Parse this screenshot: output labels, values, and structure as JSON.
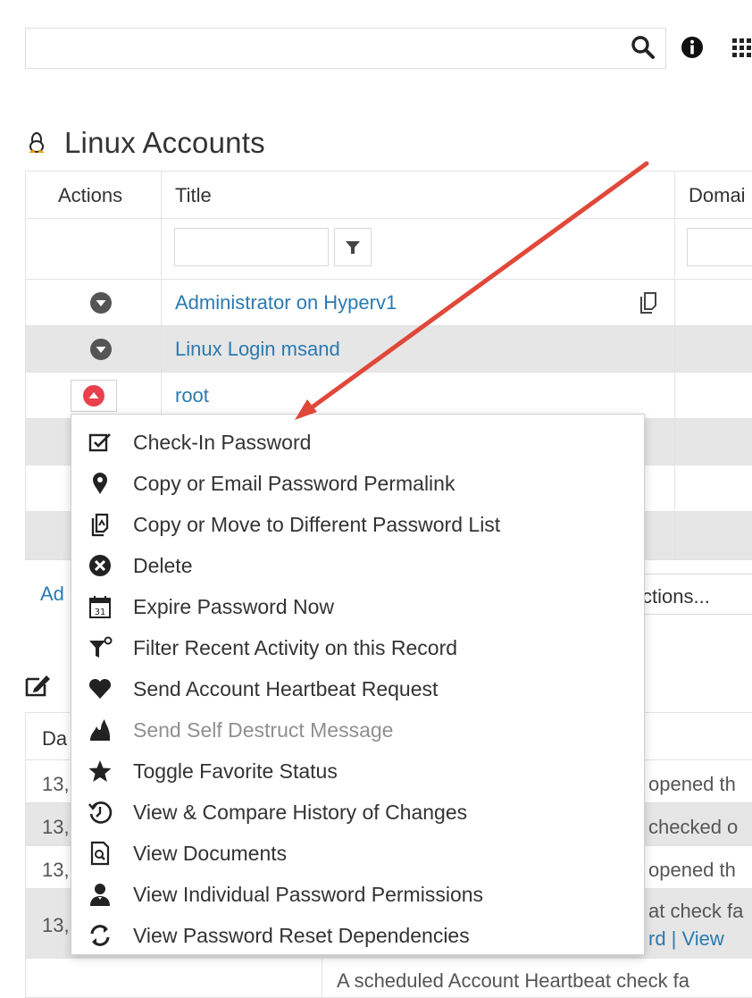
{
  "search": {
    "value": "",
    "placeholder": ""
  },
  "section": {
    "title": "Linux Accounts"
  },
  "grid": {
    "columns": [
      "Actions",
      "Title",
      "Domai"
    ],
    "rows": [
      {
        "title": "Administrator on Hyperv1"
      },
      {
        "title": "Linux Login msand"
      },
      {
        "title": "root"
      }
    ]
  },
  "lower": {
    "add_link": "Ad",
    "actions_label": "ctions...",
    "activity_header": "Da",
    "activity_rows": [
      {
        "date": "13,",
        "desc": "opened th"
      },
      {
        "date": "13,",
        "desc": "checked o"
      },
      {
        "date": "13,",
        "desc": "opened th"
      },
      {
        "date": "13,",
        "desc": "at check fa",
        "links": "rd  |  View"
      },
      {
        "date": "",
        "desc": "A scheduled Account Heartbeat check fa"
      }
    ]
  },
  "menu": {
    "items": [
      {
        "label": "Check-In Password",
        "icon": "check-in-icon"
      },
      {
        "label": "Copy or Email Password Permalink",
        "icon": "map-pin-icon"
      },
      {
        "label": "Copy or Move to Different Password List",
        "icon": "copy-move-icon"
      },
      {
        "label": "Delete",
        "icon": "delete-icon"
      },
      {
        "label": "Expire Password Now",
        "icon": "calendar-icon"
      },
      {
        "label": "Filter Recent Activity on this Record",
        "icon": "filter-icon"
      },
      {
        "label": "Send Account Heartbeat Request",
        "icon": "heart-icon"
      },
      {
        "label": "Send Self Destruct Message",
        "icon": "fire-icon",
        "disabled": true
      },
      {
        "label": "Toggle Favorite Status",
        "icon": "star-icon"
      },
      {
        "label": "View & Compare History of Changes",
        "icon": "history-icon"
      },
      {
        "label": "View Documents",
        "icon": "document-icon"
      },
      {
        "label": "View Individual Password Permissions",
        "icon": "user-icon"
      },
      {
        "label": "View Password Reset Dependencies",
        "icon": "refresh-icon"
      }
    ]
  },
  "colors": {
    "link": "#2a7ab0",
    "arrow": "#e0483a",
    "active_action": "#e8414b"
  }
}
